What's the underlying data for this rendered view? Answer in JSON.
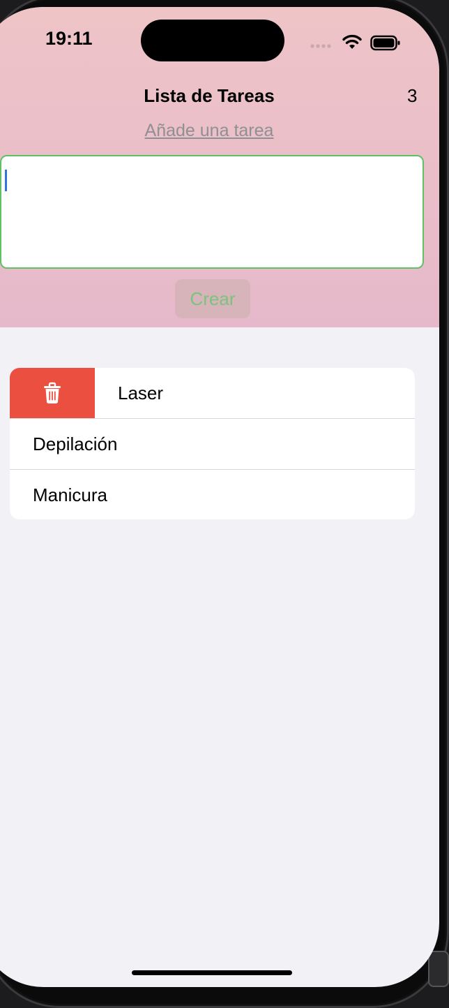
{
  "status_bar": {
    "time": "19:11",
    "icons": [
      "signal-dots-icon",
      "wifi-icon",
      "battery-icon"
    ]
  },
  "header": {
    "title": "Lista de Tareas",
    "count": "3",
    "subtitle": "Añade una tarea",
    "input_value": "",
    "create_label": "Crear"
  },
  "tasks": [
    {
      "label": "Laser",
      "swipe_action": "trash-icon"
    },
    {
      "label": "Depilación"
    },
    {
      "label": "Manicura"
    }
  ],
  "colors": {
    "header_bg": "#ebc0c9",
    "input_border": "#5fc164",
    "create_text": "#7cc37d",
    "delete_bg": "#eb4f40",
    "list_bg": "#f2f1f6"
  }
}
